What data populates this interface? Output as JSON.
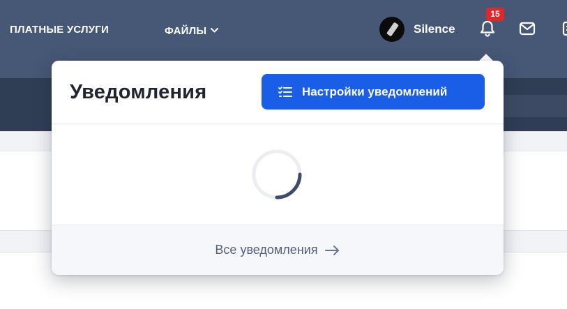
{
  "nav": {
    "paid_services": "ПЛАТНЫЕ УСЛУГИ",
    "files": "ФАЙЛЫ",
    "username": "Silence",
    "notification_count": "15"
  },
  "popup": {
    "title": "Уведомления",
    "settings_button": "Настройки уведомлений",
    "all_link": "Все уведомления",
    "loading": true
  },
  "colors": {
    "header": "#465876",
    "subheader": "#2f3e55",
    "accent": "#1a5ee8",
    "badge": "#e0282a"
  },
  "icons": [
    "chevron-down-icon",
    "bell-icon",
    "mail-icon",
    "list-settings-icon",
    "spinner-icon",
    "arrow-right-icon"
  ]
}
